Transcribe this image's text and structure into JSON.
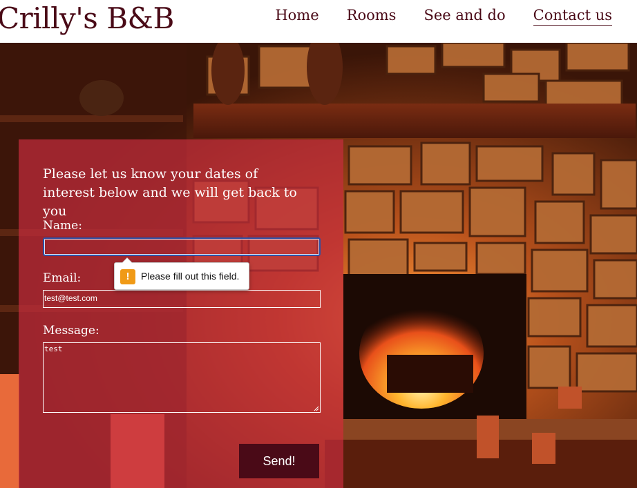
{
  "header": {
    "brand": "Crilly's B&B",
    "nav": [
      {
        "label": "Home"
      },
      {
        "label": "Rooms"
      },
      {
        "label": "See and do"
      },
      {
        "label": "Contact us"
      }
    ]
  },
  "form": {
    "heading": "Please let us know your dates of interest below and we will get back to you",
    "name_label": "Name:",
    "name_value": "",
    "email_label": "Email:",
    "email_value": "test@test.com",
    "message_label": "Message:",
    "message_value": "test",
    "send_label": "Send!"
  },
  "validation": {
    "icon": "warning-icon",
    "glyph": "!",
    "message": "Please fill out this field."
  },
  "colors": {
    "brand": "#4a0a17",
    "panel": "#c32d3c",
    "focus": "#2e4fa3",
    "warning": "#f09a16"
  }
}
